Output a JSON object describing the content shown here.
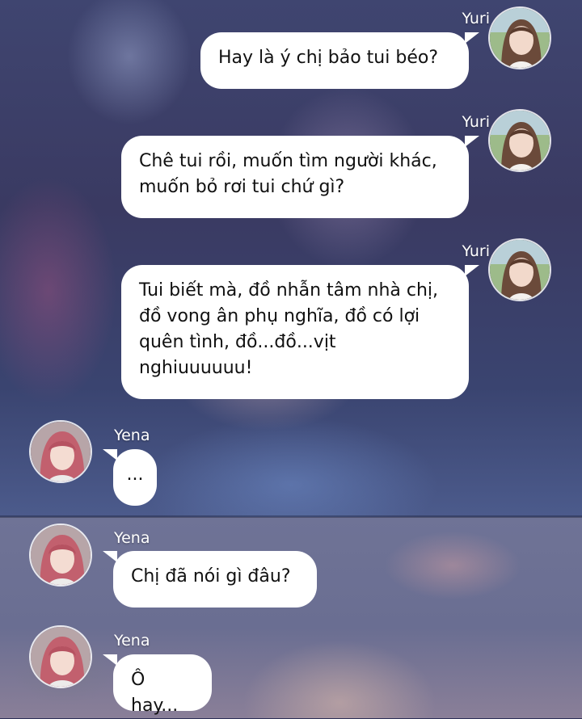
{
  "messages": [
    {
      "sender": "Yuri",
      "side": "right",
      "text": "Hay là ý chị bảo tui béo?"
    },
    {
      "sender": "Yuri",
      "side": "right",
      "text": "Chê tui rồi, muốn tìm người khác, muốn bỏ rơi tui chứ gì?"
    },
    {
      "sender": "Yuri",
      "side": "right",
      "text": "Tui biết mà, đồ nhẫn tâm nhà chị, đồ vong ân phụ nghĩa, đồ có lợi quên tình, đồ...đồ...vịt nghiuuuuuu!"
    },
    {
      "sender": "Yena",
      "side": "left",
      "text": "..."
    },
    {
      "sender": "Yena",
      "side": "left",
      "text": "Chị đã nói gì đâu?"
    },
    {
      "sender": "Yena",
      "side": "left",
      "text": "Ô hay..."
    }
  ],
  "colors": {
    "bubble": "#ffffff",
    "text": "#111111",
    "name": "#ffffff"
  },
  "icons": {
    "yuri_avatar": "avatar-yuri",
    "yena_avatar": "avatar-yena"
  }
}
